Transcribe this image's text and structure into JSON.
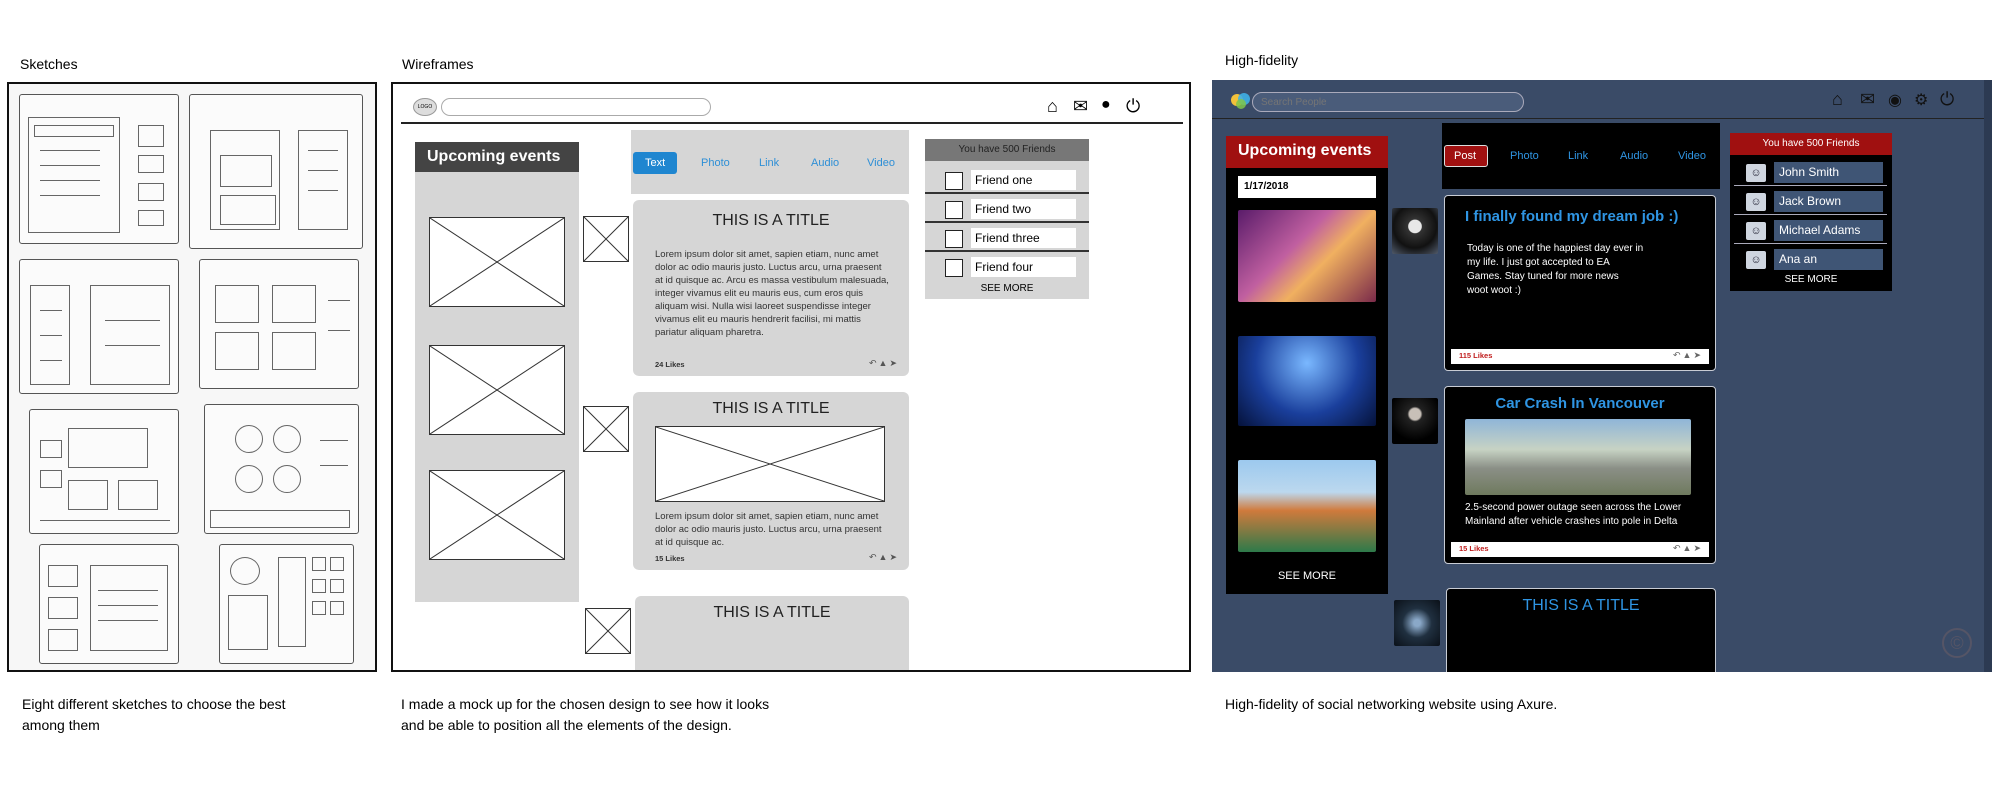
{
  "sections": {
    "sketches": {
      "title": "Sketches",
      "caption_line1": "Eight different sketches to choose the best",
      "caption_line2": "among them"
    },
    "wireframes": {
      "title": "Wireframes",
      "caption_line1": "I made a mock up for the chosen design to see how it looks",
      "caption_line2": "and be able to position all the elements of the design."
    },
    "highfidelity": {
      "title": "High-fidelity",
      "caption_line1": "High-fidelity of social networking website using Axure."
    }
  },
  "wireframe": {
    "logo": "LOGO",
    "events_title": "Upcoming events",
    "tabs": [
      "Text",
      "Photo",
      "Link",
      "Audio",
      "Video"
    ],
    "friends_header": "You have 500 Friends",
    "friends": [
      "Friend one",
      "Friend two",
      "Friend three",
      "Friend four"
    ],
    "see_more": "SEE MORE",
    "posts": [
      {
        "title": "THIS IS A TITLE",
        "body": "Lorem ipsum dolor sit amet, sapien etiam, nunc amet dolor ac odio mauris justo. Luctus arcu, urna praesent at id quisque ac. Arcu es massa vestibulum malesuada, integer vivamus elit eu mauris eus, cum eros quis aliquam wisi. Nulla wisi laoreet suspendisse integer vivamus elit eu mauris hendrerit facilisi, mi mattis pariatur aliquam pharetra.",
        "likes": "24 Likes"
      },
      {
        "title": "THIS IS A TITLE",
        "body": "Lorem ipsum dolor sit amet, sapien etiam, nunc amet dolor ac odio mauris justo. Luctus arcu, urna praesent at id quisque ac.",
        "likes": "15 Likes"
      },
      {
        "title": "THIS IS A TITLE"
      }
    ]
  },
  "highfidelity": {
    "search_placeholder": "Search People",
    "events_title": "Upcoming events",
    "date": "1/17/2018",
    "see_more": "SEE MORE",
    "tabs": [
      "Post",
      "Photo",
      "Link",
      "Audio",
      "Video"
    ],
    "friends_header": "You have 500 Friends",
    "friends": [
      "John Smith",
      "Jack Brown",
      "Michael Adams",
      "Ana an"
    ],
    "friends_see_more": "SEE MORE",
    "posts": [
      {
        "title": "I finally found my dream job :)",
        "body_lines": [
          "Today is one of the happiest day ever in",
          "my life. I just got accepted to EA",
          "Games. Stay tuned for more news",
          "woot woot :)"
        ],
        "likes": "115 Likes"
      },
      {
        "title": "Car Crash In Vancouver",
        "body_lines": [
          "2.5-second power outage seen across the Lower",
          "Mainland after vehicle crashes into pole in Delta"
        ],
        "likes": "15 Likes"
      },
      {
        "title": "THIS IS A TITLE"
      }
    ],
    "colors": {
      "background": "#3a4b67",
      "accent_red": "#a01010",
      "link_blue": "#2f95e3"
    }
  }
}
